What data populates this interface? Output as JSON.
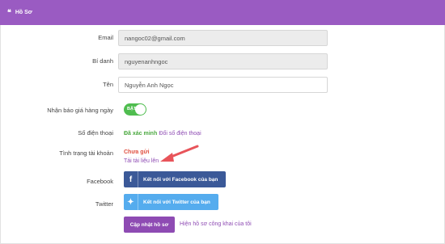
{
  "header": {
    "icon": "quote-icon",
    "title": "Hồ Sơ"
  },
  "form": {
    "email": {
      "label": "Email",
      "value": "nangoc02@gmail.com"
    },
    "alias": {
      "label": "Bí danh",
      "value": "nguyenanhngoc"
    },
    "name": {
      "label": "Tên",
      "value": "Nguyễn Anh Ngọc"
    },
    "daily_price": {
      "label": "Nhận báo giá hàng ngày",
      "toggle_text": "BẬT",
      "on": true
    },
    "phone": {
      "label": "Số điện thoại",
      "status": "Đã xác minh",
      "change_link": "Đổi số điện thoại"
    },
    "account_status": {
      "label": "Tình trạng tài khoản",
      "status": "Chưa gửi",
      "upload_link": "Tải tài liệu lên"
    },
    "facebook": {
      "label": "Facebook",
      "button": "Kết nối với Facebook của bạn"
    },
    "twitter": {
      "label": "Twitter",
      "button": "Kết nối với Twitter của bạn"
    }
  },
  "actions": {
    "update_button": "Cập nhật hồ sơ",
    "public_profile_link": "Hiện hồ sơ công khai của tôi"
  },
  "colors": {
    "header": "#9a5bc2",
    "accent": "#8e4bb3",
    "verified": "#4aa83f",
    "warning": "#e05040",
    "facebook": "#3b5998",
    "twitter": "#55acee",
    "arrow": "#e8545a"
  }
}
